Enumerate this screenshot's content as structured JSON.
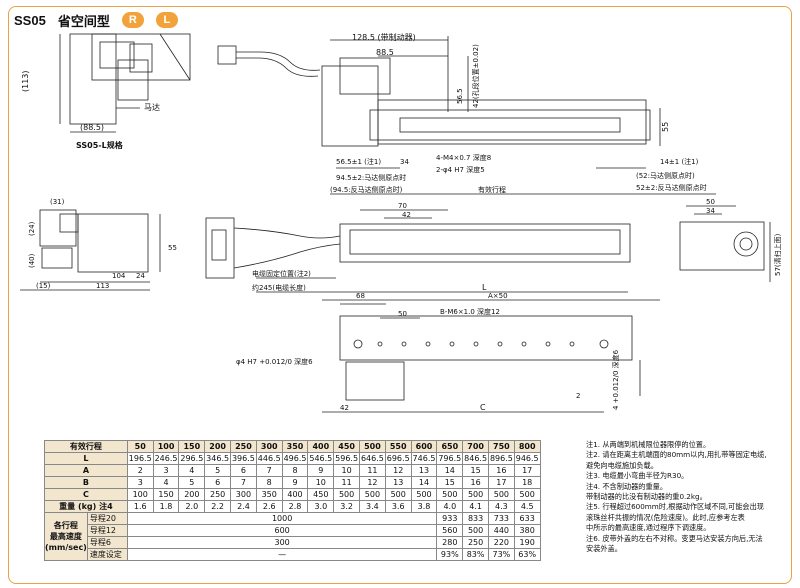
{
  "header": {
    "model": "SS05",
    "title": "省空间型",
    "badges": [
      "R",
      "L"
    ]
  },
  "drawing_labels": {
    "top_dim_a": "128.5 (带制动器)",
    "top_dim_b": "88.5",
    "dim_113": "(113)",
    "dim_88_5": "(88.5)",
    "motor": "马达",
    "spec_tag": "SS05-L规格",
    "dim_56_5": "56.5",
    "dim_42_note": "42(孔段位置±0.02)",
    "dim_55": "55",
    "note_56_5": "56.5±1 (注1)",
    "dim_34": "34",
    "note_m4": "4-M4×0.7 深度8",
    "note_phi4": "2-φ4 H7  深度5",
    "note_94_5a": "94.5±2:马达侧原点时",
    "note_94_5b": "(94.5:反马达侧原点时)",
    "stroke": "有效行程",
    "note_14": "14±1 (注1)",
    "note_52a": "(52:马达侧原点时)",
    "note_52b": "52±2:反马达侧原点时",
    "dim_31": "(31)",
    "dim_24": "(24)",
    "dim_40": "(40)",
    "dim_15": "(15)",
    "dim_104": "104",
    "dim_24b": "24",
    "dim_113b": "113",
    "dim_55b": "55",
    "dim_70": "70",
    "dim_42": "42",
    "cable_fix": "电缆固定位置(注2)",
    "cable_len": "约245(电缆长度)",
    "dim_L": "L",
    "dim_50": "50",
    "dim_34b": "34",
    "dim_57": "57(清扫上面)",
    "dim_68": "68",
    "dim_AX50": "A×50",
    "dim_50b": "50",
    "note_bm6": "B-M6×1.0 深度12",
    "note_phi4b": "φ4 H7  +0.012/0  深度6",
    "dim_C": "C",
    "dim_42c": "42",
    "dim_2": "2",
    "note_4": "4 +0.012/0 深度6"
  },
  "table": {
    "header_label": "有效行程",
    "strokes": [
      "50",
      "100",
      "150",
      "200",
      "250",
      "300",
      "350",
      "400",
      "450",
      "500",
      "550",
      "600",
      "650",
      "700",
      "750",
      "800"
    ],
    "rows": [
      {
        "label": "L",
        "values": [
          "196.5",
          "246.5",
          "296.5",
          "346.5",
          "396.5",
          "446.5",
          "496.5",
          "546.5",
          "596.5",
          "646.5",
          "696.5",
          "746.5",
          "796.5",
          "846.5",
          "896.5",
          "946.5"
        ]
      },
      {
        "label": "A",
        "values": [
          "2",
          "3",
          "4",
          "5",
          "6",
          "7",
          "8",
          "9",
          "10",
          "11",
          "12",
          "13",
          "14",
          "15",
          "16",
          "17"
        ]
      },
      {
        "label": "B",
        "values": [
          "3",
          "4",
          "5",
          "6",
          "7",
          "8",
          "9",
          "10",
          "11",
          "12",
          "13",
          "14",
          "15",
          "16",
          "17",
          "18"
        ]
      },
      {
        "label": "C",
        "values": [
          "100",
          "150",
          "200",
          "250",
          "300",
          "350",
          "400",
          "450",
          "500",
          "500",
          "500",
          "500",
          "500",
          "500",
          "500",
          "500"
        ]
      },
      {
        "label": "重量 (kg) 注4",
        "values": [
          "1.6",
          "1.8",
          "2.0",
          "2.2",
          "2.4",
          "2.6",
          "2.8",
          "3.0",
          "3.2",
          "3.4",
          "3.6",
          "3.8",
          "4.0",
          "4.1",
          "4.3",
          "4.5"
        ]
      }
    ],
    "speed_group_label": "各行程\n最高速度\n(mm/sec)",
    "speed_rows": [
      {
        "sub": "导程20",
        "merged": "1000",
        "tail": [
          "933",
          "833",
          "733",
          "633"
        ]
      },
      {
        "sub": "导程12",
        "merged": "600",
        "tail": [
          "560",
          "500",
          "440",
          "380"
        ]
      },
      {
        "sub": "导程6",
        "merged": "300",
        "tail": [
          "280",
          "250",
          "220",
          "190"
        ]
      },
      {
        "sub": "速度设定",
        "merged": "—",
        "tail": [
          "93%",
          "83%",
          "73%",
          "63%"
        ]
      }
    ]
  },
  "notes": [
    "注1. 从两端到机械限位器限停的位置。",
    "注2. 请在距离主机端面的80mm以内,用扎带等固定电缆,",
    "      避免向电缆施加负载。",
    "注3. 电缆最小弯曲半径为R30。",
    "注4. 不含制动器的重量。",
    "      带制动器的比没有制动器的重0.2kg。",
    "注5. 行程超过600mm时,根据动作区域不同,可能会出现",
    "      滚珠丝杆共振的情况(危险速度)。此时,应参考左表",
    "      中所示的最高速度,通过程序下调速度。",
    "注6. 皮带外盖的左右不对称。变更马达安装方向后,无法",
    "      安装外盖。"
  ],
  "colors": {
    "accent": "#f2a23a",
    "border": "#e8a24a",
    "table_header": "#f3e6cf"
  }
}
